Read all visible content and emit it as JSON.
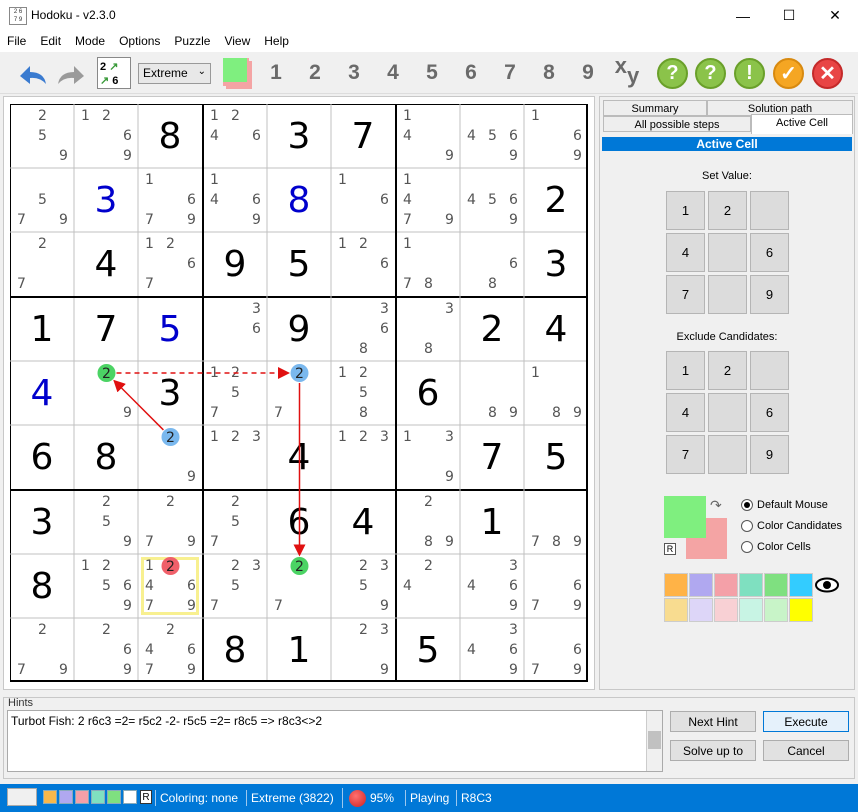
{
  "window": {
    "title": "Hodoku - v2.3.0",
    "minimize": "—",
    "maximize": "☐",
    "close": "✕"
  },
  "menu": [
    "File",
    "Edit",
    "Mode",
    "Options",
    "Puzzle",
    "View",
    "Help"
  ],
  "toolbar": {
    "level": "Extreme",
    "numbers": [
      "1",
      "2",
      "3",
      "4",
      "5",
      "6",
      "7",
      "8",
      "9"
    ],
    "xy": "xy",
    "icons": [
      "undo-icon",
      "redo-icon",
      "hint-icon",
      "hint-icon",
      "exclamation-icon",
      "check-icon",
      "cancel-icon"
    ]
  },
  "colors": {
    "given": "#000000",
    "user": "#0000cc",
    "candidate": "#555555",
    "accent": "#0078d7",
    "green": "#4bd364",
    "blue": "#7ab8ee",
    "red": "#f0606a",
    "arrow": "#e01010"
  },
  "board": [
    [
      {
        "c": [
          2,
          5,
          9
        ]
      },
      {
        "c": [
          1,
          2,
          6,
          9
        ]
      },
      {
        "v": "8"
      },
      {
        "c": [
          1,
          2,
          4,
          6
        ]
      },
      {
        "v": "3"
      },
      {
        "v": "7"
      },
      {
        "c": [
          1,
          4,
          9
        ]
      },
      {
        "c": [
          4,
          5,
          6,
          9
        ]
      },
      {
        "c": [
          1,
          6,
          9
        ]
      }
    ],
    [
      {
        "c": [
          5,
          7,
          9
        ]
      },
      {
        "v": "3",
        "u": true
      },
      {
        "c": [
          1,
          6,
          7,
          9
        ]
      },
      {
        "c": [
          1,
          4,
          6,
          9
        ]
      },
      {
        "v": "8",
        "u": true
      },
      {
        "c": [
          1,
          6
        ]
      },
      {
        "c": [
          1,
          4,
          7,
          9
        ]
      },
      {
        "c": [
          4,
          5,
          6,
          9
        ]
      },
      {
        "v": "2"
      }
    ],
    [
      {
        "c": [
          2,
          7
        ]
      },
      {
        "v": "4"
      },
      {
        "c": [
          1,
          2,
          6,
          7
        ]
      },
      {
        "v": "9"
      },
      {
        "v": "5"
      },
      {
        "c": [
          1,
          2,
          6
        ]
      },
      {
        "c": [
          1,
          7,
          8
        ]
      },
      {
        "c": [
          6,
          8
        ]
      },
      {
        "v": "3"
      }
    ],
    [
      {
        "v": "1"
      },
      {
        "v": "7"
      },
      {
        "v": "5",
        "u": true
      },
      {
        "c": [
          3,
          6
        ]
      },
      {
        "v": "9"
      },
      {
        "c": [
          3,
          6,
          8
        ]
      },
      {
        "c": [
          3,
          8
        ]
      },
      {
        "v": "2"
      },
      {
        "v": "4"
      }
    ],
    [
      {
        "v": "4",
        "u": true
      },
      {
        "c": [
          2,
          9
        ]
      },
      {
        "v": "3"
      },
      {
        "c": [
          1,
          2,
          5,
          7
        ]
      },
      {
        "c": [
          2,
          7
        ]
      },
      {
        "c": [
          1,
          2,
          5,
          8
        ]
      },
      {
        "v": "6"
      },
      {
        "c": [
          8,
          9
        ]
      },
      {
        "c": [
          1,
          8,
          9
        ]
      }
    ],
    [
      {
        "v": "6"
      },
      {
        "v": "8"
      },
      {
        "c": [
          2,
          9
        ]
      },
      {
        "c": [
          1,
          2,
          3
        ]
      },
      {
        "v": "4"
      },
      {
        "c": [
          1,
          2,
          3
        ]
      },
      {
        "c": [
          1,
          3,
          9
        ]
      },
      {
        "v": "7"
      },
      {
        "v": "5"
      }
    ],
    [
      {
        "v": "3"
      },
      {
        "c": [
          2,
          5,
          9
        ]
      },
      {
        "c": [
          2,
          7,
          9
        ]
      },
      {
        "c": [
          2,
          5,
          7
        ]
      },
      {
        "v": "6"
      },
      {
        "v": "4"
      },
      {
        "c": [
          2,
          8,
          9
        ]
      },
      {
        "v": "1"
      },
      {
        "c": [
          7,
          8,
          9
        ]
      }
    ],
    [
      {
        "v": "8"
      },
      {
        "c": [
          1,
          2,
          5,
          6,
          9
        ]
      },
      {
        "c": [
          1,
          2,
          4,
          6,
          7,
          9
        ]
      },
      {
        "c": [
          2,
          3,
          5,
          7
        ]
      },
      {
        "c": [
          2,
          7
        ]
      },
      {
        "c": [
          2,
          3,
          5,
          9
        ]
      },
      {
        "c": [
          2,
          4
        ]
      },
      {
        "c": [
          3,
          4,
          6,
          9
        ]
      },
      {
        "c": [
          6,
          7,
          9
        ]
      }
    ],
    [
      {
        "c": [
          2,
          7,
          9
        ]
      },
      {
        "c": [
          2,
          6,
          9
        ]
      },
      {
        "c": [
          2,
          4,
          6,
          7,
          9
        ]
      },
      {
        "v": "8"
      },
      {
        "v": "1"
      },
      {
        "c": [
          2,
          3,
          9
        ]
      },
      {
        "v": "5"
      },
      {
        "c": [
          3,
          4,
          6,
          9
        ]
      },
      {
        "c": [
          6,
          7,
          9
        ]
      }
    ]
  ],
  "markers": [
    {
      "r": 4,
      "c": 1,
      "d": 2,
      "color": "green"
    },
    {
      "r": 5,
      "c": 2,
      "d": 2,
      "color": "blue"
    },
    {
      "r": 4,
      "c": 4,
      "d": 2,
      "color": "blue"
    },
    {
      "r": 7,
      "c": 4,
      "d": 2,
      "color": "green"
    },
    {
      "r": 7,
      "c": 2,
      "d": 2,
      "color": "red"
    }
  ],
  "selected_cell": {
    "r": 7,
    "c": 2
  },
  "panel": {
    "tabs_top": [
      "Summary",
      "Solution path"
    ],
    "tabs_bottom": [
      "All possible steps",
      "Active Cell"
    ],
    "header": "Active Cell",
    "set_value_label": "Set Value:",
    "set_value": [
      "1",
      "2",
      "",
      "4",
      "",
      "6",
      "7",
      "",
      "9"
    ],
    "exclude_label": "Exclude Candidates:",
    "exclude": [
      "1",
      "2",
      "",
      "4",
      "",
      "6",
      "7",
      "",
      "9"
    ],
    "radios": [
      "Default Mouse",
      "Color Candidates",
      "Color Cells"
    ],
    "radio_selected": 0,
    "r_label": "R",
    "swatches_row1": [
      "#ffb347",
      "#b0a8f0",
      "#f4a0a8",
      "#7fe0c0",
      "#7fe080",
      "#33ccff"
    ],
    "swatches_row2": [
      "#f8dc90",
      "#ddd6f8",
      "#f8d0d4",
      "#c8f4e4",
      "#c8f4c8",
      "#ffff00"
    ],
    "primary_color": "#7fef7f",
    "secondary_color": "#f4a4a4"
  },
  "hints": {
    "label": "Hints",
    "text": "Turbot Fish: 2 r6c3 =2= r5c2 -2- r5c5 =2= r8c5 => r8c3<>2",
    "buttons": {
      "next": "Next Hint",
      "execute": "Execute",
      "solve": "Solve up to",
      "cancel": "Cancel"
    }
  },
  "status": {
    "coloring": "Coloring: none",
    "level": "Extreme (3822)",
    "progress": "95%",
    "mode": "Playing",
    "cell": "R8C3",
    "r_label": "R",
    "swatches": [
      "#f8b84a",
      "#b0a8f0",
      "#f4a0a8",
      "#7fe0c0",
      "#7fe080",
      "#ffffff"
    ]
  }
}
